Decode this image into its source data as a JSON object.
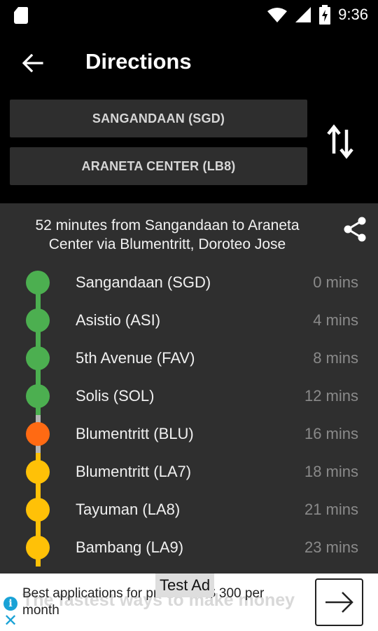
{
  "status_bar": {
    "time": "9:36",
    "icons": [
      "sd-card-icon",
      "wifi-icon",
      "cellular-signal-icon",
      "battery-charging-icon"
    ]
  },
  "toolbar": {
    "back_icon": "arrow-left-icon",
    "title": "Directions"
  },
  "stations": {
    "from": "SANGANDAAN (SGD)",
    "to": "ARANETA CENTER (LB8)",
    "swap_icon": "swap-vertical-icon"
  },
  "route": {
    "summary": "52 minutes from Sangandaan to Araneta Center via Blumentritt, Doroteo Jose",
    "share_icon": "share-icon",
    "stops": [
      {
        "name": "Sangandaan (SGD)",
        "time": "0 mins",
        "color": "#4caf50",
        "line_color": "#4caf50"
      },
      {
        "name": "Asistio (ASI)",
        "time": "4 mins",
        "color": "#4caf50",
        "line_color": "#4caf50"
      },
      {
        "name": "5th Avenue (FAV)",
        "time": "8 mins",
        "color": "#4caf50",
        "line_color": "#4caf50"
      },
      {
        "name": "Solis (SOL)",
        "time": "12 mins",
        "color": "#4caf50",
        "line_color": "#4caf50"
      },
      {
        "name": "Blumentritt (BLU)",
        "time": "16 mins",
        "color": "#ff6a13",
        "line_color": "#b5b5b5"
      },
      {
        "name": "Blumentritt (LA7)",
        "time": "18 mins",
        "color": "#ffc107",
        "line_color": "#ffc107"
      },
      {
        "name": "Tayuman (LA8)",
        "time": "21 mins",
        "color": "#ffc107",
        "line_color": "#ffc107"
      },
      {
        "name": "Bambang (LA9)",
        "time": "23 mins",
        "color": "#ffc107",
        "line_color": "#ffc107"
      }
    ]
  },
  "ad": {
    "label": "Test Ad",
    "ghost_text": "The fastest ways to make money",
    "text": "Best applications for profit. Get $ 300 per month",
    "info_icon": "info-icon",
    "close_icon": "close-icon",
    "arrow_icon": "arrow-right-icon"
  }
}
